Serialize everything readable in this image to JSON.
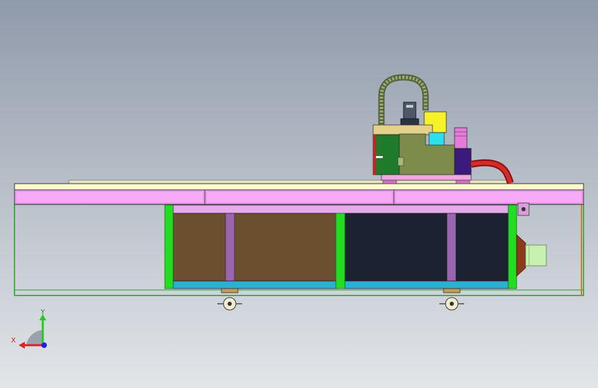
{
  "triad": {
    "y_label": "Y",
    "x_label": "X"
  },
  "colors": {
    "bg_top": "#8f9aaa",
    "bg_bottom": "#e2e5e8",
    "table_top": "#fffbcc",
    "table_skirt": "#f7aaf7",
    "frame_green": "#22dd22",
    "cabinet_brown": "#6b4f2e",
    "cabinet_dark": "#1b2333",
    "cabinet_base": "#2ab0d0",
    "divider_purple": "#9b64b0",
    "head_olive": "#7d8c4a",
    "head_navy": "#3a1a7a",
    "cable_chain": "#8a9a6a",
    "hose_red": "#cc2222",
    "exhaust_brown": "#8b3a1e",
    "exhaust_pipe": "#c8f0b0",
    "axis_y": "#22cc22",
    "axis_x": "#dd2222",
    "axis_z": "#2222dd"
  },
  "icons": [
    "coordinate-triad-icon",
    "caster-wheel-icon"
  ]
}
